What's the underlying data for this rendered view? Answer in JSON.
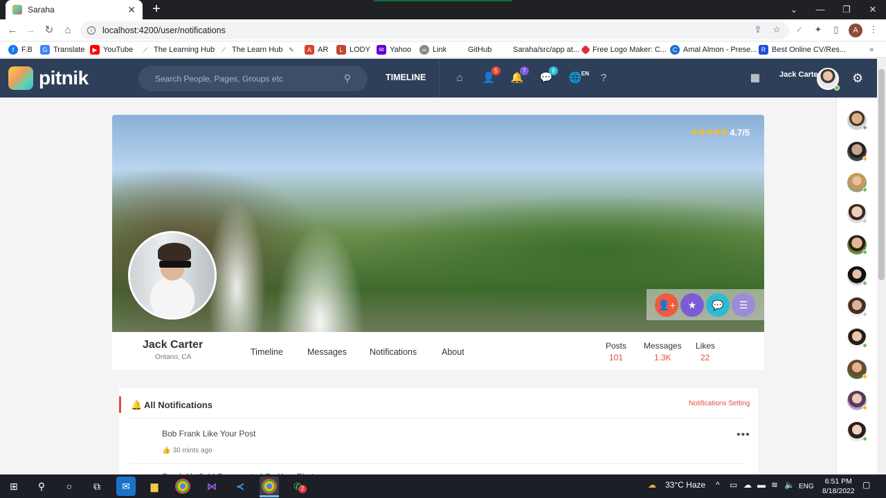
{
  "browser": {
    "tab_title": "Saraha",
    "url": "localhost:4200/user/notifications",
    "profile_initial": "A"
  },
  "bookmarks": [
    {
      "label": "F.B",
      "color": "#1877f2"
    },
    {
      "label": "Translate",
      "color": "#4285f4"
    },
    {
      "label": "YouTube",
      "color": "#ff0000"
    },
    {
      "label": "The Learning Hub",
      "color": "#555555"
    },
    {
      "label": "The Learn Hub",
      "color": "#555555"
    },
    {
      "label": "",
      "color": "#555555"
    },
    {
      "label": "AR",
      "color": "#d9412b"
    },
    {
      "label": "LODY",
      "color": "#c2452f"
    },
    {
      "label": "Yahoo",
      "color": "#6001d2"
    },
    {
      "label": "Link",
      "color": "#777777"
    },
    {
      "label": "GitHub",
      "color": "#ffffff"
    },
    {
      "label": "Saraha/src/app at...",
      "color": "#ffffff"
    },
    {
      "label": "Free Logo Maker: C...",
      "color": "#e5293c"
    },
    {
      "label": "Amal Almon - Prese...",
      "color": "#1a6fd0"
    },
    {
      "label": "Best Online CV/Res...",
      "color": "#1d4ed8"
    }
  ],
  "header": {
    "brand": "pitnik",
    "search_placeholder": "Search People, Pages, Groups etc",
    "timeline_label": "TIMELINE",
    "badges": {
      "friends": "5",
      "notifications": "7",
      "messages": "9"
    },
    "lang": "EN",
    "user_name": "Jack Carter",
    "badge_colors": {
      "friends": "#e44a3c",
      "notifications": "#7c5cd6",
      "messages": "#2bbcd4"
    }
  },
  "cover": {
    "rating": "4.7/5",
    "stars": "★★★★★"
  },
  "profile": {
    "name": "Jack Carter",
    "location": "Ontario, CA",
    "tabs": [
      "Timeline",
      "Messages",
      "Notifications",
      "About"
    ],
    "stats": [
      {
        "label": "Posts",
        "value": "101"
      },
      {
        "label": "Messages",
        "value": "1.3K"
      },
      {
        "label": "Likes",
        "value": "22"
      }
    ]
  },
  "notifications": {
    "title": "All Notifications",
    "settings_label": "Notifications Setting",
    "items": [
      {
        "text": "Bob Frank Like Your Post",
        "time": "30 mints ago"
      },
      {
        "text": "Sarah Hetfield Commented On Your Photo",
        "time": ""
      }
    ]
  },
  "taskbar": {
    "weather": "33°C Haze",
    "lang": "ENG",
    "time": "6:51 PM",
    "date": "8/18/2022",
    "whatsapp_badge": "2"
  }
}
